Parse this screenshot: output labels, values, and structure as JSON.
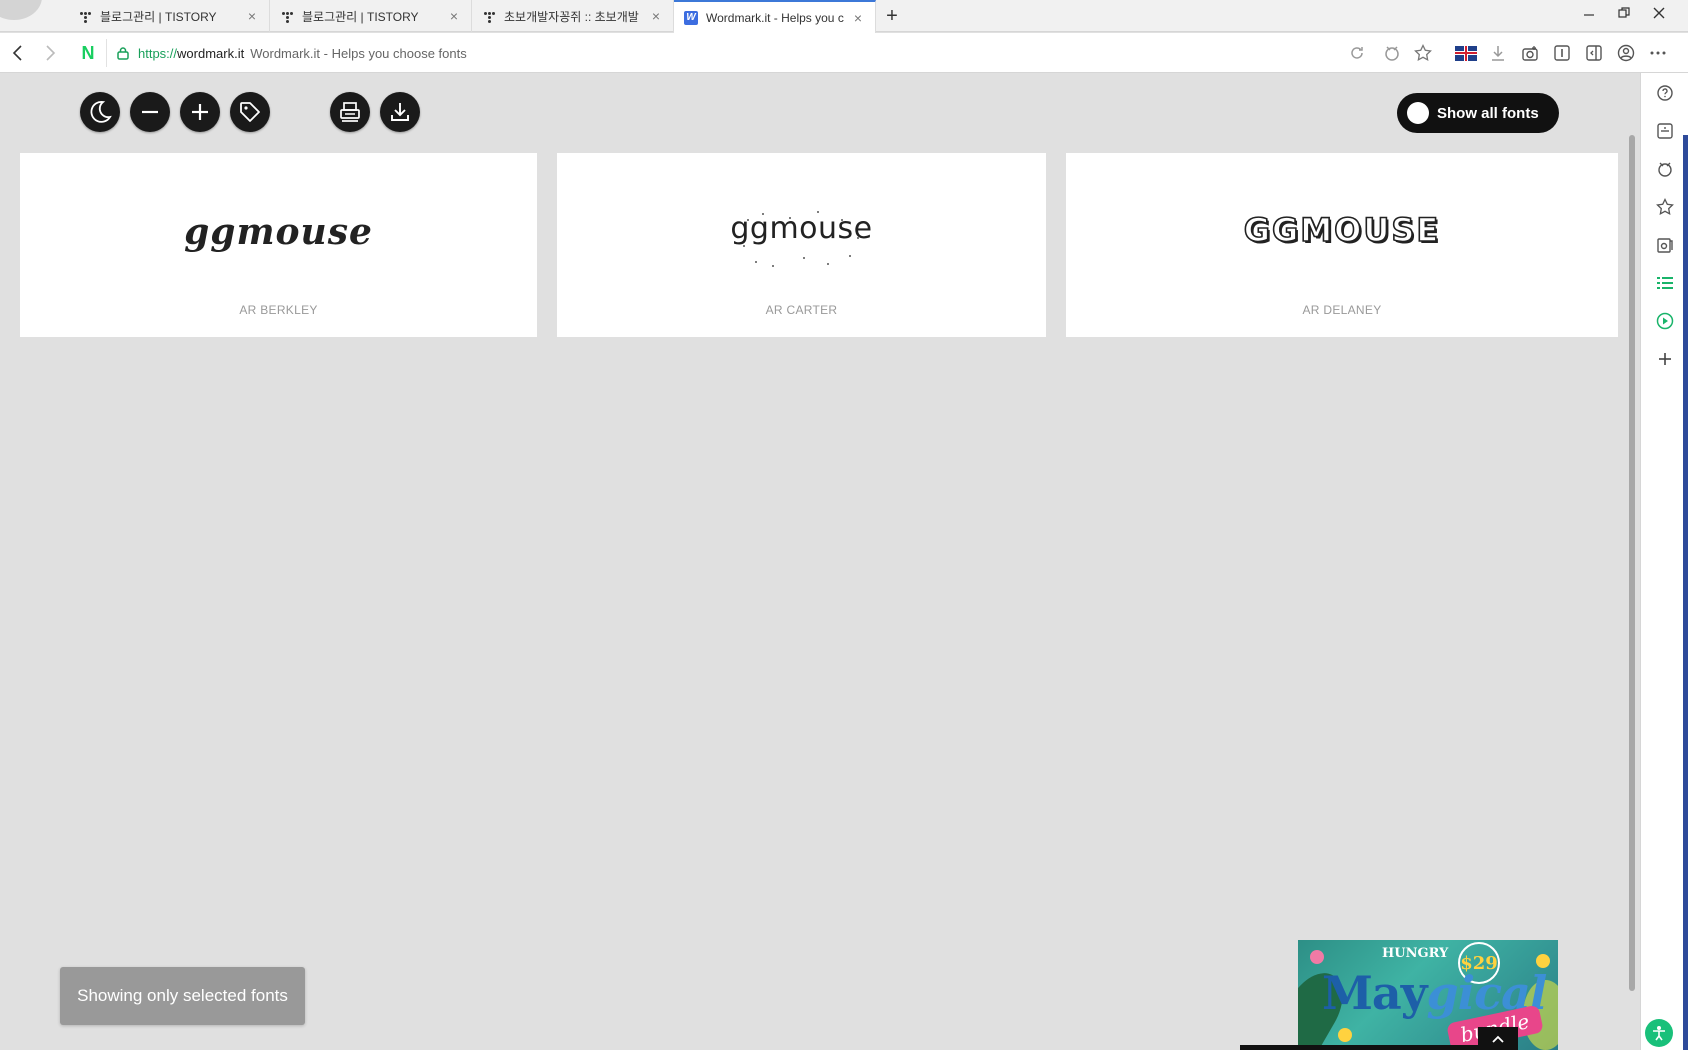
{
  "tabs": [
    {
      "title": "블로그관리 | TISTORY",
      "icon": "tistory-icon",
      "active": false
    },
    {
      "title": "블로그관리 | TISTORY",
      "icon": "tistory-icon",
      "active": false
    },
    {
      "title": "초보개발자꽁쥐 :: 초보개발",
      "icon": "tistory-icon",
      "active": false
    },
    {
      "title": "Wordmark.it - Helps you c",
      "icon": "wordmark-icon",
      "active": true
    }
  ],
  "address": {
    "scheme": "https://",
    "host": "wordmark.it",
    "page_title": "Wordmark.it - Helps you choose fonts"
  },
  "browser": {
    "logo": "N",
    "new_tab": "+"
  },
  "toolbar": {
    "buttons": [
      "moon-icon",
      "minus-icon",
      "plus-icon",
      "tag-icon",
      "print-icon",
      "download-icon"
    ],
    "toggle_label": "Show all fonts"
  },
  "fonts": [
    {
      "sample": "ggmouse",
      "name": "AR BERKLEY"
    },
    {
      "sample": "ggmouse",
      "name": "AR CARTER"
    },
    {
      "sample": "GGMOUSE",
      "name": "AR DELANEY"
    }
  ],
  "toast": {
    "text": "Showing only selected fonts"
  },
  "ad": {
    "brand": "HUNGRY",
    "price": "$29",
    "headline_a": "May",
    "headline_b": "gical",
    "tag": "bundle"
  },
  "colors": {
    "page_bg": "#e0e0e0",
    "button_bg": "#1a1a1a",
    "naver_green": "#19ce60",
    "active_tab_accent": "#3c78d8"
  }
}
